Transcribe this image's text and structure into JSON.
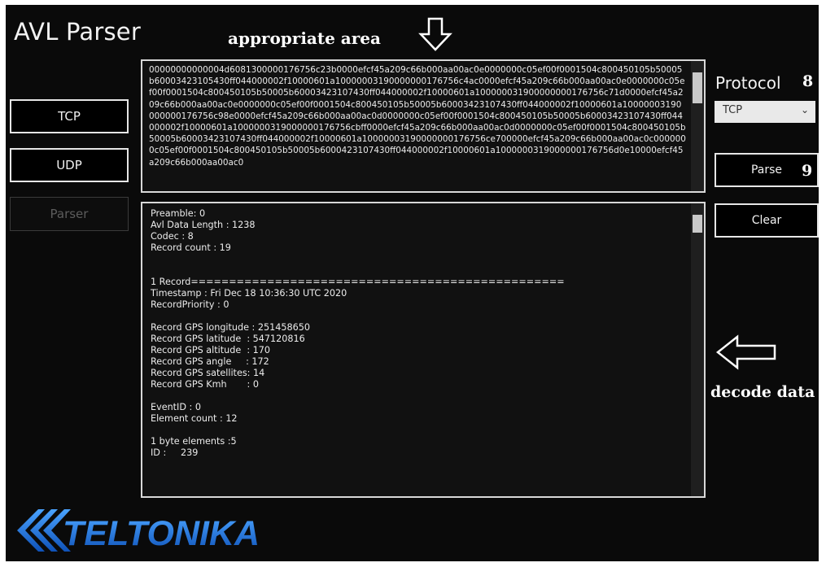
{
  "app": {
    "title": "AVL Parser"
  },
  "annotations": {
    "appropriate_area": "appropriate area",
    "decode_data": "decode data",
    "protocol_num": "8",
    "parse_num": "9"
  },
  "left_buttons": {
    "tcp": "TCP",
    "udp": "UDP",
    "parser": "Parser"
  },
  "protocol": {
    "label": "Protocol",
    "selected": "TCP"
  },
  "right_buttons": {
    "parse": "Parse",
    "clear": "Clear"
  },
  "input_hex": "00000000000004d6081300000176756c23b0000efcf45a209c66b000aa00ac0e0000000c05ef00f0001504c800450105b50005b60003423105430ff044000002f10000601a10000003190000000176756c4ac0000efcf45a209c66b000aa00ac0e0000000c05ef00f0001504c800450105b50005b60003423107430ff044000002f10000601a100000031900000000176756c71d0000efcf45a209c66b000aa00ac0e0000000c05ef00f0001504c800450105b50005b60003423107430ff044000002f10000601a10000003190000000176756c98e0000efcf45a209c66b000aa00ac0d0000000c05ef00f0001504c800450105b50005b60003423107430ff044000002f10000601a1000000319000000176756cbff0000efcf45a209c66b000aa00ac0d0000000c05ef00f0001504c800450105b50005b60003423107430ff044000002f10000601a10000003190000000176756ce700000efcf45a209c66b000aa00ac0c0000000c05ef00f0001504c800450105b50005b6000423107430ff044000002f10000601a1000000319000000176756d0e10000efcf45a209c66b000aa00ac0",
  "decoded_text": "Preamble: 0\nAvl Data Length : 1238\nCodec : 8\nRecord count : 19\n\n\n1 Record=================================================\nTimestamp : Fri Dec 18 10:36:30 UTC 2020\nRecordPriority : 0\n\nRecord GPS longitude : 251458650\nRecord GPS latitude  : 547120816\nRecord GPS altitude  : 170\nRecord GPS angle     : 172\nRecord GPS satellites: 14\nRecord GPS Kmh       : 0\n\nEventID : 0\nElement count : 12\n\n1 byte elements :5\nID :     239",
  "brand": {
    "logo_text": "TELTONIKA",
    "color": "#1e6fd9"
  }
}
